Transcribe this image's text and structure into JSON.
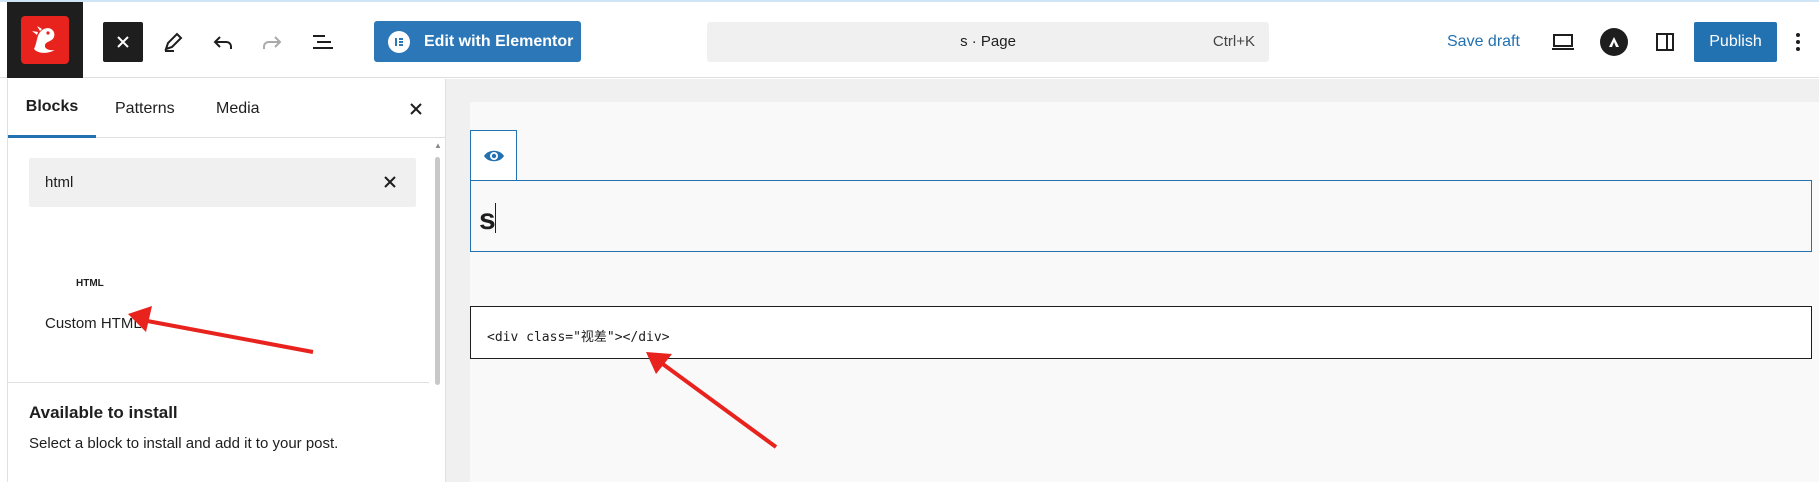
{
  "toolbar": {
    "close_icon": "close-icon",
    "edit_elementor_label": "Edit with Elementor",
    "document_title": "s · Page",
    "document_shortcut": "Ctrl+K",
    "save_draft_label": "Save draft",
    "publish_label": "Publish"
  },
  "sidebar": {
    "tabs": [
      {
        "label": "Blocks",
        "active": true
      },
      {
        "label": "Patterns",
        "active": false
      },
      {
        "label": "Media",
        "active": false
      }
    ],
    "search_value": "html",
    "result_block": {
      "icon_text": "HTML",
      "label": "Custom HTML"
    },
    "available_title": "Available to install",
    "available_desc": "Select a block to install and add it to your post."
  },
  "canvas": {
    "page_title": "s",
    "html_code": "<div class=\"视差\"></div>"
  },
  "colors": {
    "accent": "#2271b1",
    "elementor": "#2b77b8",
    "logo_red": "#e8231e",
    "annotation_arrow": "#e8231e"
  }
}
